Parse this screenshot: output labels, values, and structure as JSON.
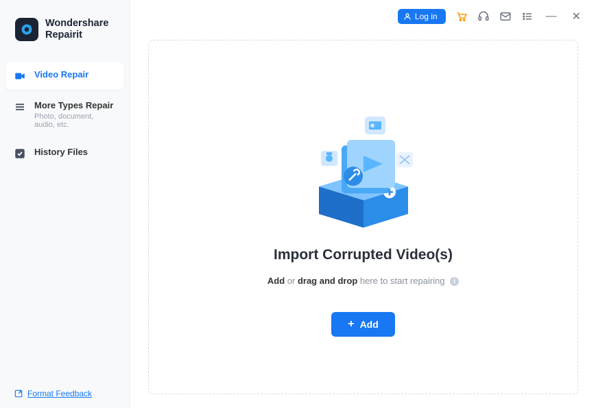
{
  "brand": {
    "line1": "Wondershare",
    "line2": "Repairit"
  },
  "sidebar": {
    "items": [
      {
        "label": "Video Repair",
        "sublabel": ""
      },
      {
        "label": "More Types Repair",
        "sublabel": "Photo, document, audio, etc."
      },
      {
        "label": "History Files",
        "sublabel": ""
      }
    ],
    "feedback": "Format Feedback"
  },
  "titlebar": {
    "login": "Log in"
  },
  "main": {
    "heading": "Import Corrupted Video(s)",
    "sub_add": "Add",
    "sub_or": " or ",
    "sub_drag": "drag and drop",
    "sub_rest": " here to start repairing",
    "add_button": "Add"
  }
}
